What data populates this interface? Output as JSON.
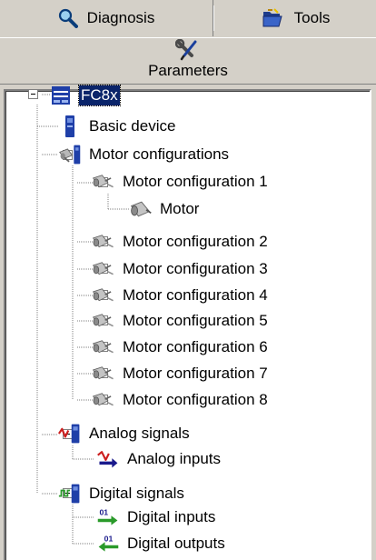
{
  "tabs": {
    "diagnosis": {
      "label": "Diagnosis",
      "icon": "magnifier-icon"
    },
    "tools": {
      "label": "Tools",
      "icon": "folder-open-icon"
    },
    "parameters": {
      "label": "Parameters",
      "icon": "wrench-screwdriver-icon"
    }
  },
  "tree": {
    "root": {
      "label": "FC8x",
      "icon": "drive-unit-icon",
      "state": "expanded",
      "selected": true
    },
    "basic_device": {
      "label": "Basic device",
      "icon": "device-icon"
    },
    "motor_configurations": {
      "label": "Motor configurations",
      "icon": "motor-group-icon",
      "state": "expanded"
    },
    "motor_configuration_1": {
      "label": "Motor configuration 1",
      "icon": "motor-config-icon",
      "state": "expanded"
    },
    "motor": {
      "label": "Motor",
      "icon": "motor-icon"
    },
    "motor_configuration_2": {
      "label": "Motor configuration 2",
      "icon": "motor-config-icon",
      "state": "collapsed"
    },
    "motor_configuration_3": {
      "label": "Motor configuration 3",
      "icon": "motor-config-icon",
      "state": "collapsed"
    },
    "motor_configuration_4": {
      "label": "Motor configuration 4",
      "icon": "motor-config-icon",
      "state": "collapsed"
    },
    "motor_configuration_5": {
      "label": "Motor configuration 5",
      "icon": "motor-config-icon",
      "state": "collapsed"
    },
    "motor_configuration_6": {
      "label": "Motor configuration 6",
      "icon": "motor-config-icon",
      "state": "collapsed"
    },
    "motor_configuration_7": {
      "label": "Motor configuration 7",
      "icon": "motor-config-icon",
      "state": "collapsed"
    },
    "motor_configuration_8": {
      "label": "Motor configuration 8",
      "icon": "motor-config-icon",
      "state": "collapsed"
    },
    "analog_signals": {
      "label": "Analog signals",
      "icon": "analog-signal-device-icon",
      "state": "expanded"
    },
    "analog_inputs": {
      "label": "Analog inputs",
      "icon": "analog-input-icon"
    },
    "digital_signals": {
      "label": "Digital signals",
      "icon": "digital-signal-device-icon",
      "state": "expanded"
    },
    "digital_inputs": {
      "label": "Digital inputs",
      "icon": "digital-input-icon"
    },
    "digital_outputs": {
      "label": "Digital outputs",
      "icon": "digital-output-icon"
    }
  },
  "colors": {
    "selection": "#0a246a",
    "panel": "#d4d0c8",
    "device_blue": "#1f3fa8",
    "signal_red": "#cc1f1f",
    "signal_green": "#2a9a2a"
  }
}
